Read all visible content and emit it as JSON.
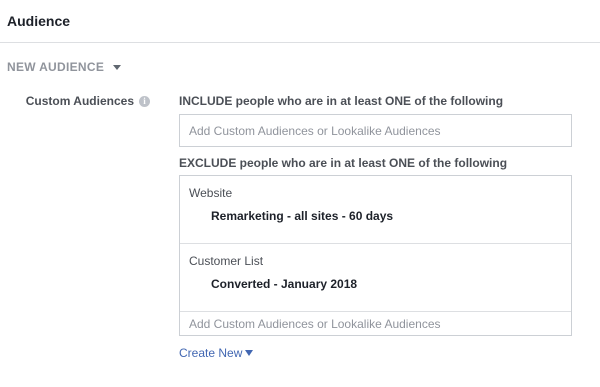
{
  "header": {
    "title": "Audience"
  },
  "section": {
    "label": "NEW AUDIENCE",
    "toggle_icon": "caret-down-icon"
  },
  "custom_audiences": {
    "label": "Custom Audiences",
    "info_icon": "info-icon",
    "include": {
      "heading": "INCLUDE people who are in at least ONE of the following",
      "placeholder": "Add Custom Audiences or Lookalike Audiences"
    },
    "exclude": {
      "heading": "EXCLUDE people who are in at least ONE of the following",
      "groups": [
        {
          "title": "Website",
          "item": "Remarketing - all sites - 60 days"
        },
        {
          "title": "Customer List",
          "item": "Converted - January 2018"
        }
      ],
      "placeholder": "Add Custom Audiences or Lookalike Audiences"
    },
    "create_new": {
      "label": "Create New",
      "icon": "caret-down-icon"
    }
  },
  "colors": {
    "link": "#4267b2",
    "border": "#ccd0d5",
    "muted_text": "#90949c",
    "label_text": "#4b4f56",
    "primary_text": "#1d2129"
  }
}
